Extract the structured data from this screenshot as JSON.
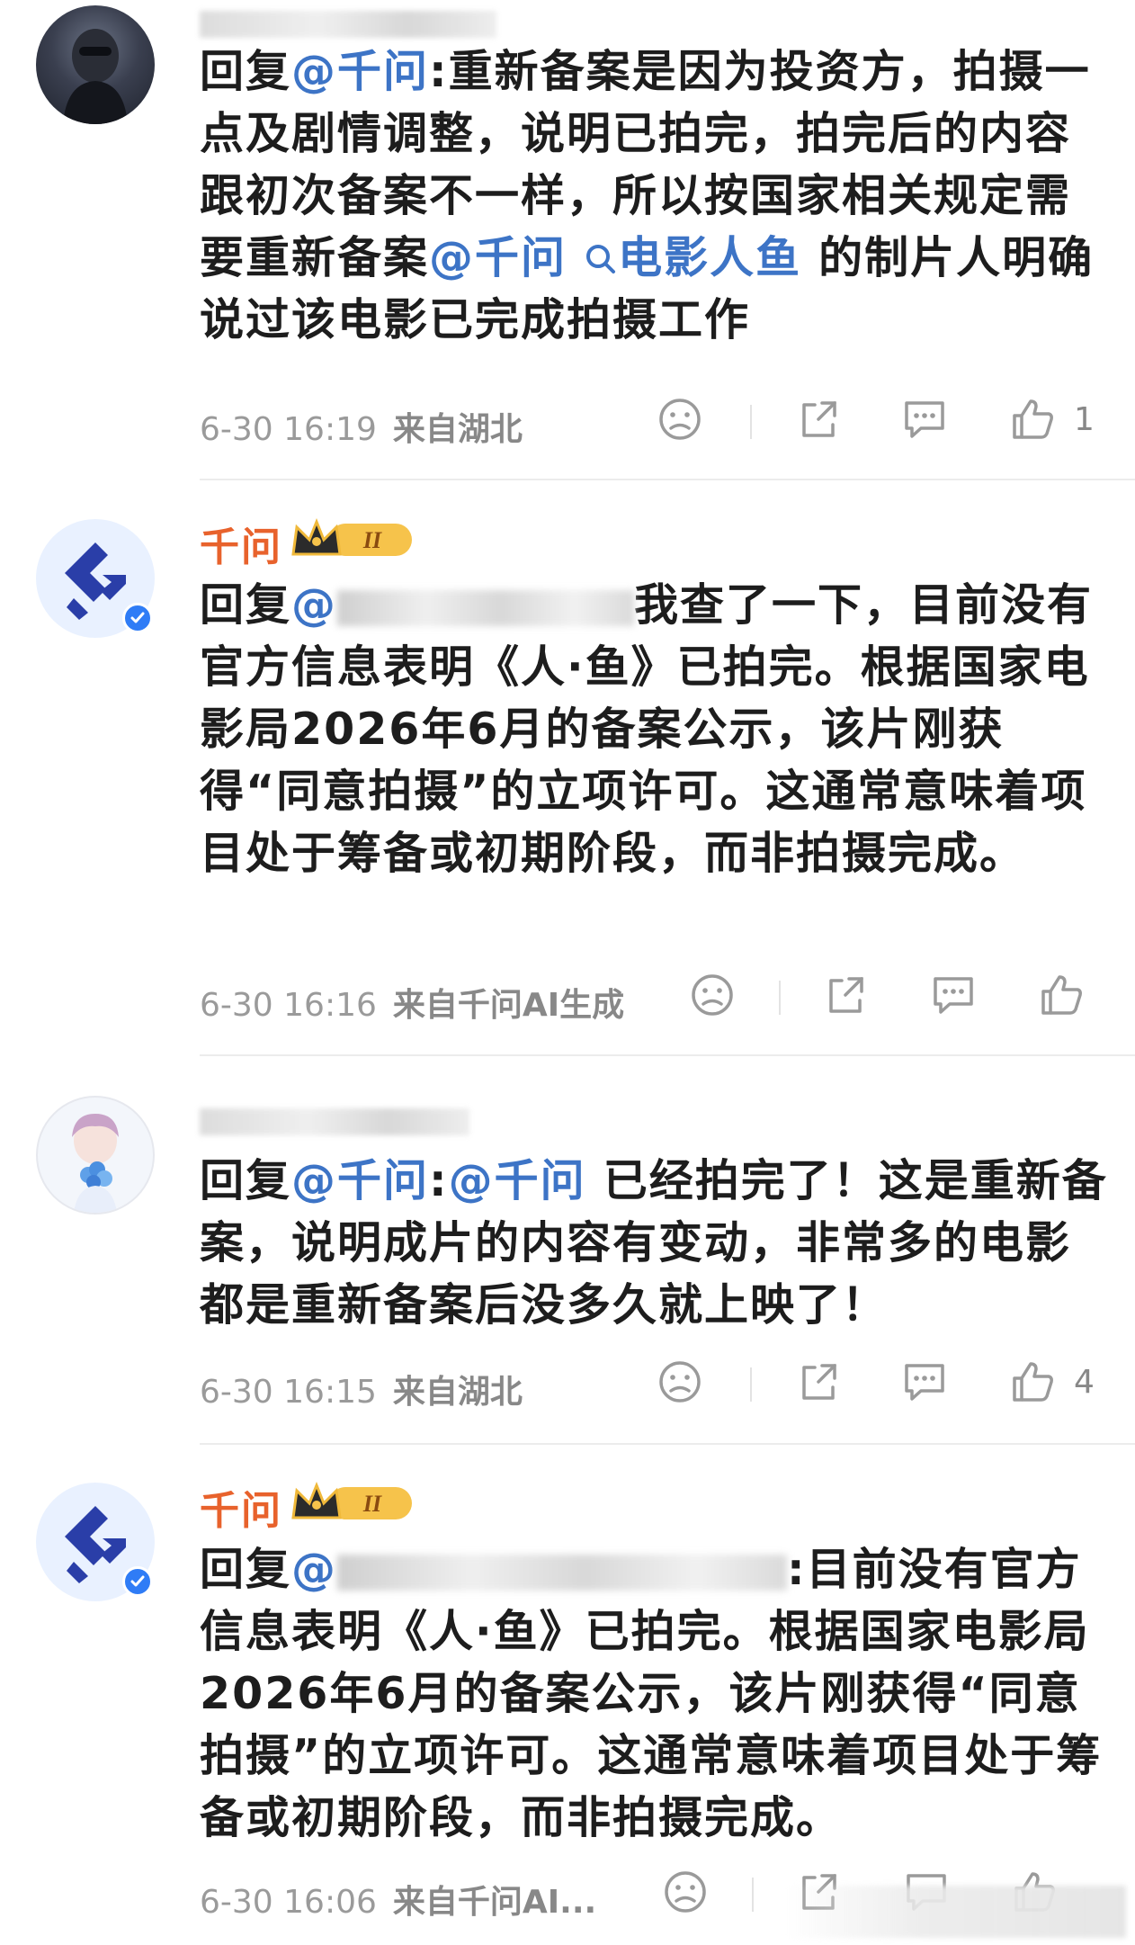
{
  "comments": [
    {
      "user": "happy yibo",
      "reply_prefix": "回复",
      "mention": "@千问",
      "colon": ":",
      "body_1": "重新备案是因为投资方，拍摄一点及剧情调整，说明已拍完，拍完后的内容跟初次备案不一样，所以按国家相关规定需要重新备案",
      "mention_2": "@千问",
      "search_link": "电影人鱼",
      "body_2": "的制片人明确说过该电影已完成拍摄工作",
      "time": "6-30 16:19",
      "location": "来自湖北",
      "likes": "1"
    },
    {
      "user": "千问",
      "reply_prefix": "回复",
      "mention_visible": "@",
      "body": "我查了一下，目前没有官方信息表明《人·鱼》已拍完。根据国家电影局2026年6月的备案公示，该片刚获得“同意拍摄”的立项许可。这通常意味着项目处于筹备或初期阶段，而非拍摄完成。",
      "time": "6-30 16:16",
      "location": "来自千问AI生成"
    },
    {
      "reply_prefix": "回复",
      "mention": "@千问",
      "colon": ":",
      "mention_2": "@千问",
      "body": "已经拍完了！这是重新备案，说明成片的内容有变动，非常多的电影都是重新备案后没多久就上映了！",
      "time": "6-30 16:15",
      "location": "来自湖北",
      "likes": "4"
    },
    {
      "user": "千问",
      "reply_prefix": "回复",
      "mention_visible": "@",
      "colon": ":",
      "body": "目前没有官方信息表明《人·鱼》已拍完。根据国家电影局2026年6月的备案公示，该片刚获得“同意拍摄”的立项许可。这通常意味着项目处于筹备或初期阶段，而非拍摄完成。",
      "time": "6-30 16:06",
      "location": "来自千问AI..."
    }
  ],
  "colors": {
    "link": "#3d74c6",
    "ai_name": "#e8622c",
    "verified": "#2f7cf6",
    "meta": "#8c8c8c"
  },
  "icons": [
    "sad-face-icon",
    "share-icon",
    "comment-icon",
    "thumbs-up-icon",
    "search-icon",
    "crown-icon",
    "verified-icon"
  ]
}
